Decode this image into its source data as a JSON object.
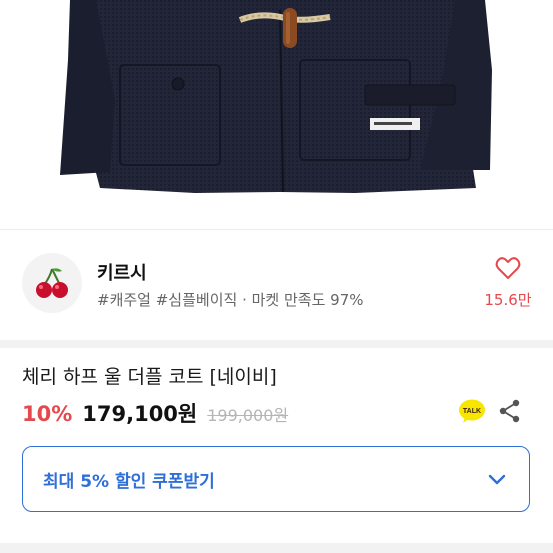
{
  "brand": {
    "name": "키르시",
    "tags": "#캐주얼 #심플베이직 · 마켓 만족도 97%",
    "logo_icon": "cherry-icon",
    "likes": "15.6만"
  },
  "product": {
    "title": "체리 하프 울 더플 코트 [네이비]",
    "discount": "10%",
    "price": "179,100원",
    "original_price": "199,000원"
  },
  "actions": {
    "talk_label": "TALK",
    "talk_icon": "kakao-talk-icon",
    "share_icon": "share-icon"
  },
  "coupon": {
    "label": "최대 5% 할인 쿠폰받기",
    "icon": "chevron-down-icon"
  },
  "colors": {
    "accent_red": "#e5484d",
    "accent_blue": "#2f6fd8",
    "kakao_yellow": "#f7e600",
    "coat_navy": "#1f2233"
  }
}
